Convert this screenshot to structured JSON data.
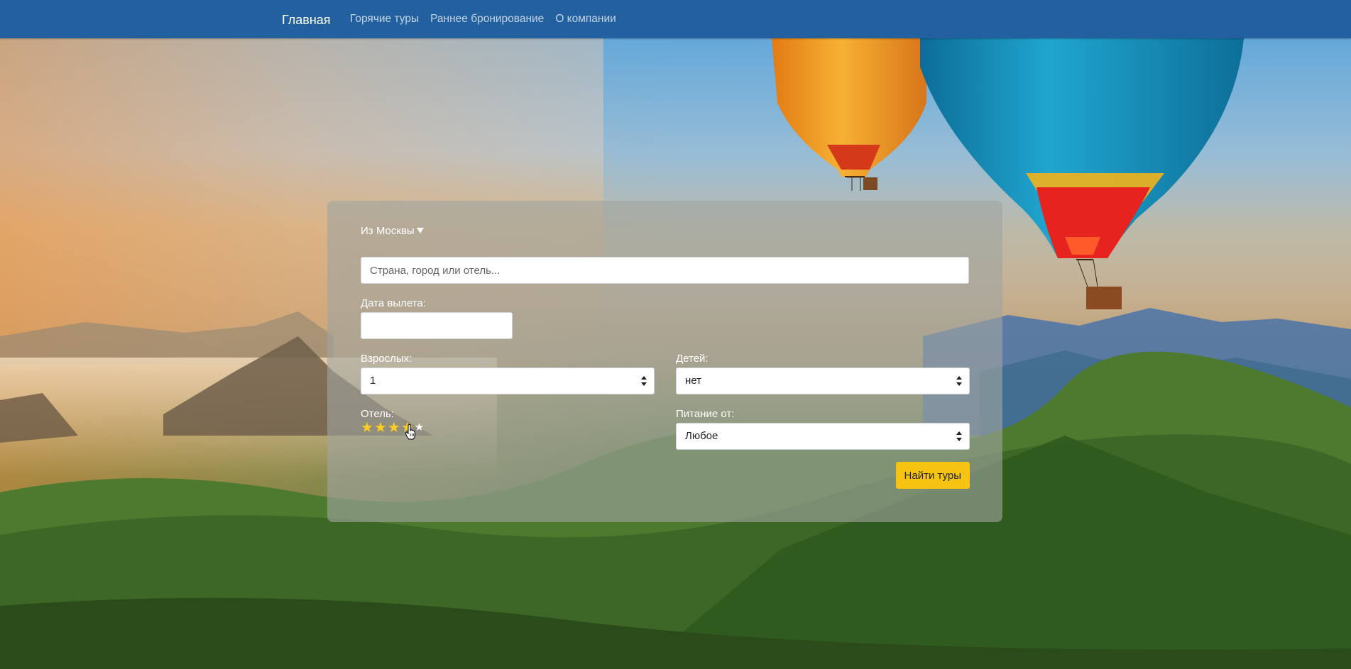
{
  "nav": {
    "brand": "Главная",
    "links": [
      "Горячие туры",
      "Раннее бронирование",
      "О компании"
    ]
  },
  "search": {
    "departure_city": "Из Москвы",
    "destination_placeholder": "Страна, город или отель...",
    "date_label": "Дата вылета:",
    "date_value": "",
    "adults_label": "Взрослых:",
    "adults_value": "1",
    "children_label": "Детей:",
    "children_value": "нет",
    "hotel_label": "Отель:",
    "hotel_stars": {
      "value": 4,
      "max": 5
    },
    "meal_label": "Питание от:",
    "meal_value": "Любое",
    "submit_label": "Найти туры"
  },
  "colors": {
    "navbar": "#2360a0",
    "submit": "#f7c311",
    "star": "#f8cd2c"
  }
}
